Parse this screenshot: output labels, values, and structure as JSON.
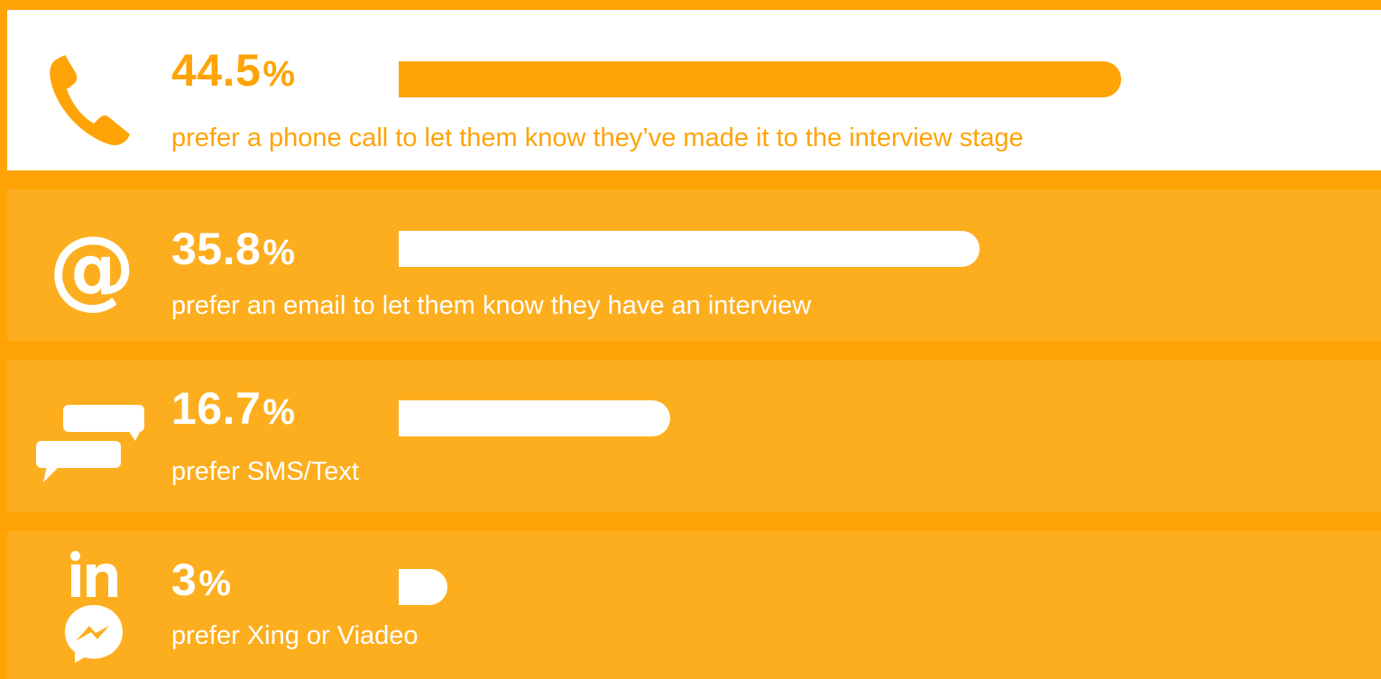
{
  "colors": {
    "accent": "#FFA306",
    "row_highlight": "#FFFFFF",
    "row_band": "#FDAE1F",
    "text_light": "#FFFFFF"
  },
  "chart_data": {
    "type": "bar",
    "orientation": "horizontal",
    "title": "",
    "xlabel": "",
    "ylabel": "",
    "xlim": [
      0,
      60
    ],
    "grid": false,
    "legend": "none",
    "categories": [
      "prefer a phone call to let them know they’ve made it to the interview stage",
      "prefer an email to let them know they have an interview",
      "prefer SMS/Text",
      "prefer Xing or Viadeo"
    ],
    "values": [
      44.5,
      35.8,
      16.7,
      3
    ]
  },
  "rows": [
    {
      "value_text": "44.5",
      "unit": "%",
      "description": "prefer a phone call to let them know they’ve made it to the interview stage",
      "icon": "phone-icon"
    },
    {
      "value_text": "35.8",
      "unit": "%",
      "description": "prefer an email to let them know they have an interview",
      "icon": "at-sign-icon"
    },
    {
      "value_text": "16.7",
      "unit": "%",
      "description": "prefer SMS/Text",
      "icon": "chat-bubbles-icon"
    },
    {
      "value_text": "3",
      "unit": "%",
      "description": "prefer Xing or Viadeo",
      "icons": [
        "linkedin-icon",
        "messenger-icon"
      ]
    }
  ]
}
